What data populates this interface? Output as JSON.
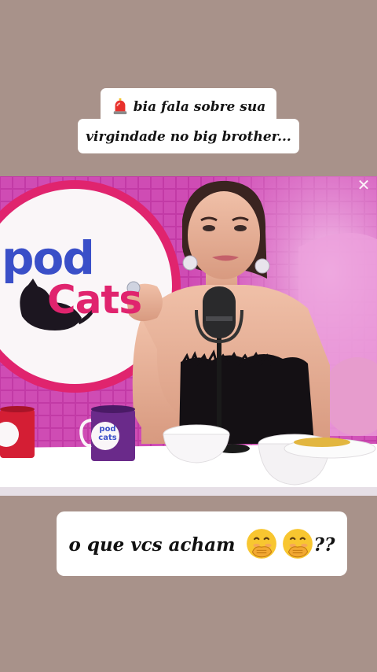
{
  "caption_top": {
    "line1": "bia fala sobre sua",
    "line2": "virgindade no big brother..."
  },
  "caption_bottom": {
    "text": "o que vcs acham",
    "suffix": "??"
  },
  "video": {
    "logo_text_pod": "pod",
    "logo_text_cats": "Cats",
    "mug_text": "pod cats",
    "close_symbol": "✕"
  },
  "icons": {
    "siren": "police-car-light",
    "emoji": "face-with-hand-over-mouth"
  },
  "colors": {
    "background": "#a8928a",
    "caption_bg": "#ffffff",
    "studio_magenta": "#d25ac0",
    "logo_ring": "#e0246e",
    "logo_blue": "#3a4fc8",
    "logo_pink": "#e0246e"
  }
}
